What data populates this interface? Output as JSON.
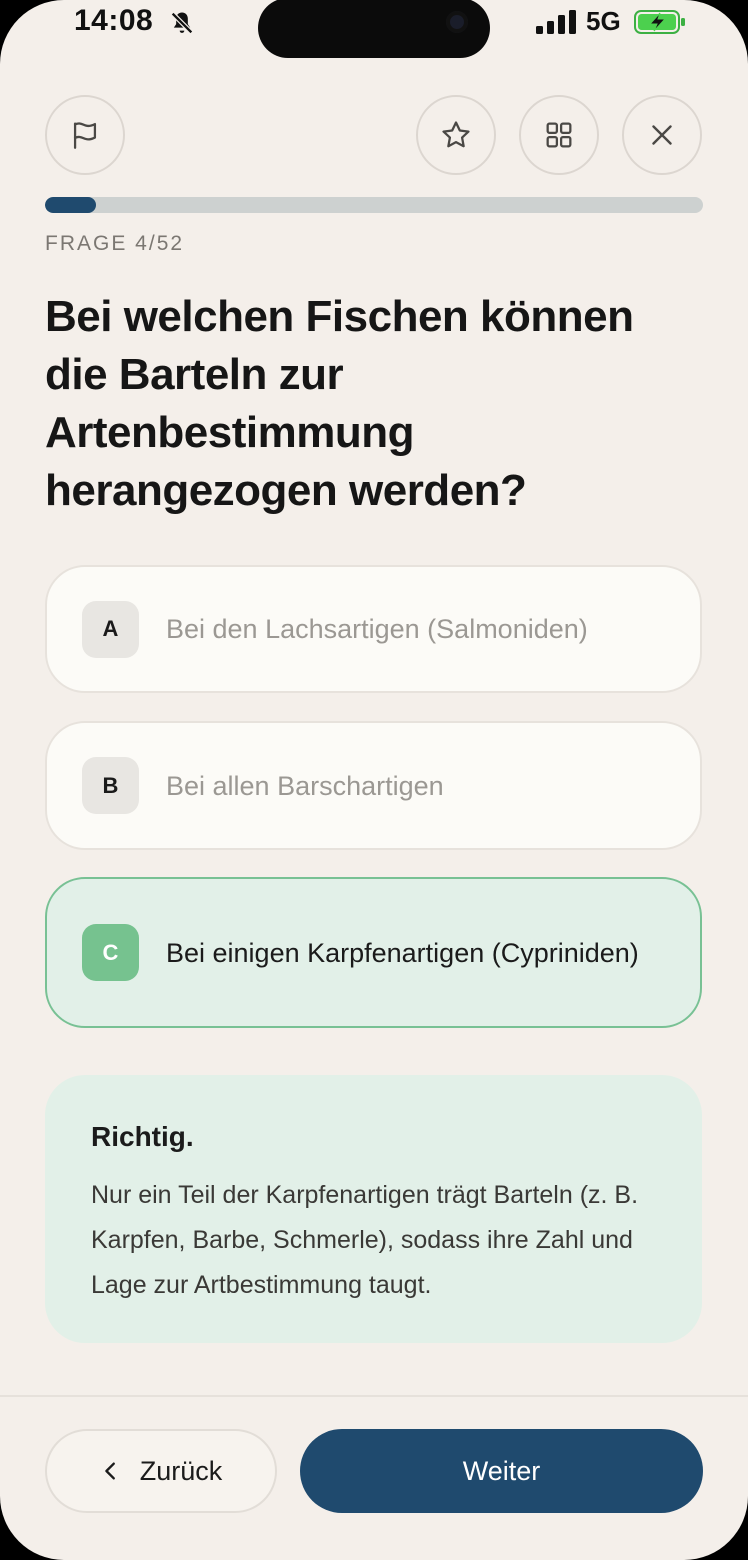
{
  "status_bar": {
    "time": "14:08",
    "network": "5G",
    "icons": [
      "bell-off-icon",
      "signal-icon",
      "battery-charging-icon"
    ]
  },
  "toolbar": {
    "icons": [
      "flag-icon",
      "star-icon",
      "grid-icon",
      "close-icon"
    ]
  },
  "progress": {
    "current": 4,
    "total": 52,
    "fraction": 0.077,
    "counter_text": "FRAGE 4/52"
  },
  "question": {
    "text": "Bei welchen Fischen können die Barteln zur Artenbestimmung herangezogen werden?"
  },
  "answers": [
    {
      "letter": "A",
      "text": "Bei den Lachsartigen (Salmoniden)",
      "state": "default"
    },
    {
      "letter": "B",
      "text": "Bei allen Barschartigen",
      "state": "default"
    },
    {
      "letter": "C",
      "text": "Bei einigen Karpfenartigen (Cypriniden)",
      "state": "correct"
    }
  ],
  "feedback": {
    "title": "Richtig.",
    "body": "Nur ein Teil der Karpfenartigen trägt Barteln (z. B. Karpfen, Barbe, Schmerle), sodass ihre Zahl und Lage zur Artbestimmung taugt."
  },
  "navigation": {
    "back_label": "Zurück",
    "next_label": "Weiter"
  },
  "colors": {
    "background": "#f4efea",
    "accent": "#1f4a6e",
    "correct_fill": "#e2f0e8",
    "correct_border": "#78c194",
    "correct_badge": "#76c28f"
  }
}
